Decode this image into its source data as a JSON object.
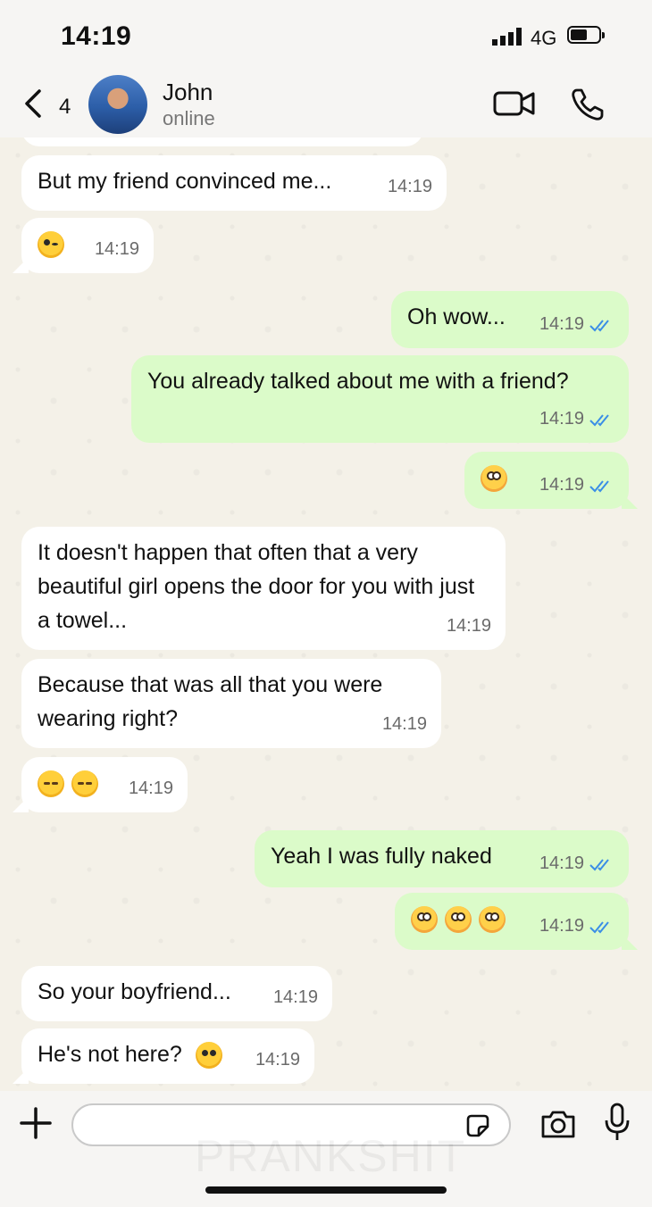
{
  "status": {
    "time": "14:19",
    "network": "4G"
  },
  "header": {
    "unread_count": "4",
    "contact_name": "John",
    "contact_status": "online"
  },
  "watermark": "PRANKSHIT",
  "messages": [
    {
      "text": "But my friend convinced me...",
      "time": "14:19",
      "dir": "in"
    },
    {
      "text": "",
      "emoji": [
        "wink"
      ],
      "time": "14:19",
      "dir": "in"
    },
    {
      "text": "Oh wow...",
      "time": "14:19",
      "dir": "out",
      "read": true
    },
    {
      "text": "You already talked about me with a friend?",
      "time": "14:19",
      "dir": "out",
      "read": true
    },
    {
      "text": "",
      "emoji": [
        "flushed"
      ],
      "time": "14:19",
      "dir": "out",
      "read": true
    },
    {
      "text": "It doesn't happen that often that a very beautiful girl opens the door for you with just a towel...",
      "time": "14:19",
      "dir": "in"
    },
    {
      "text": "Because that was all that you were wearing right?",
      "time": "14:19",
      "dir": "in"
    },
    {
      "text": "",
      "emoji": [
        "relieved",
        "relieved"
      ],
      "time": "14:19",
      "dir": "in"
    },
    {
      "text": "Yeah I was fully naked",
      "time": "14:19",
      "dir": "out",
      "read": true
    },
    {
      "text": "",
      "emoji": [
        "flushed",
        "flushed",
        "flushed"
      ],
      "time": "14:19",
      "dir": "out",
      "read": true
    },
    {
      "text": "So your boyfriend...",
      "time": "14:19",
      "dir": "in"
    },
    {
      "text": "He's not here?",
      "emoji_after": "tongue",
      "time": "14:19",
      "dir": "in"
    }
  ],
  "input": {
    "placeholder": ""
  },
  "colors": {
    "outgoing": "#dbfbc9",
    "incoming": "#ffffff",
    "read_ticks": "#3a8ee6"
  },
  "icons": [
    "back-chevron-icon",
    "video-call-icon",
    "phone-icon",
    "plus-icon",
    "sticker-icon",
    "camera-icon",
    "microphone-icon"
  ]
}
